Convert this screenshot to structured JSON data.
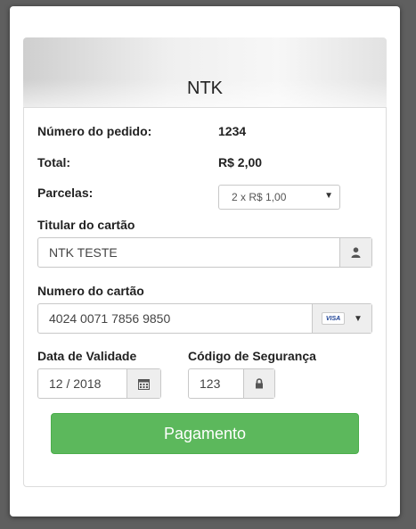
{
  "header": {
    "title": "NTK"
  },
  "order": {
    "number_label": "Número do pedido:",
    "number_value": "1234",
    "total_label": "Total:",
    "total_value": "R$ 2,00",
    "installments_label": "Parcelas:",
    "installments_selected": "2 x R$ 1,00"
  },
  "card": {
    "holder_label": "Titular do cartão",
    "holder_value": "NTK TESTE",
    "holder_icon": "user-icon",
    "number_label": "Numero do cartão",
    "number_value": "4024 0071 7856 9850",
    "brand_badge": "VISA",
    "expiry_label": "Data de Validade",
    "expiry_value": "12 / 2018",
    "expiry_icon": "calendar-icon",
    "cvv_label": "Código de Segurança",
    "cvv_value": "123",
    "cvv_icon": "lock-icon"
  },
  "actions": {
    "pay_label": "Pagamento"
  },
  "colors": {
    "pay_button": "#5cb85c",
    "visa_brand": "#1a3f93"
  }
}
